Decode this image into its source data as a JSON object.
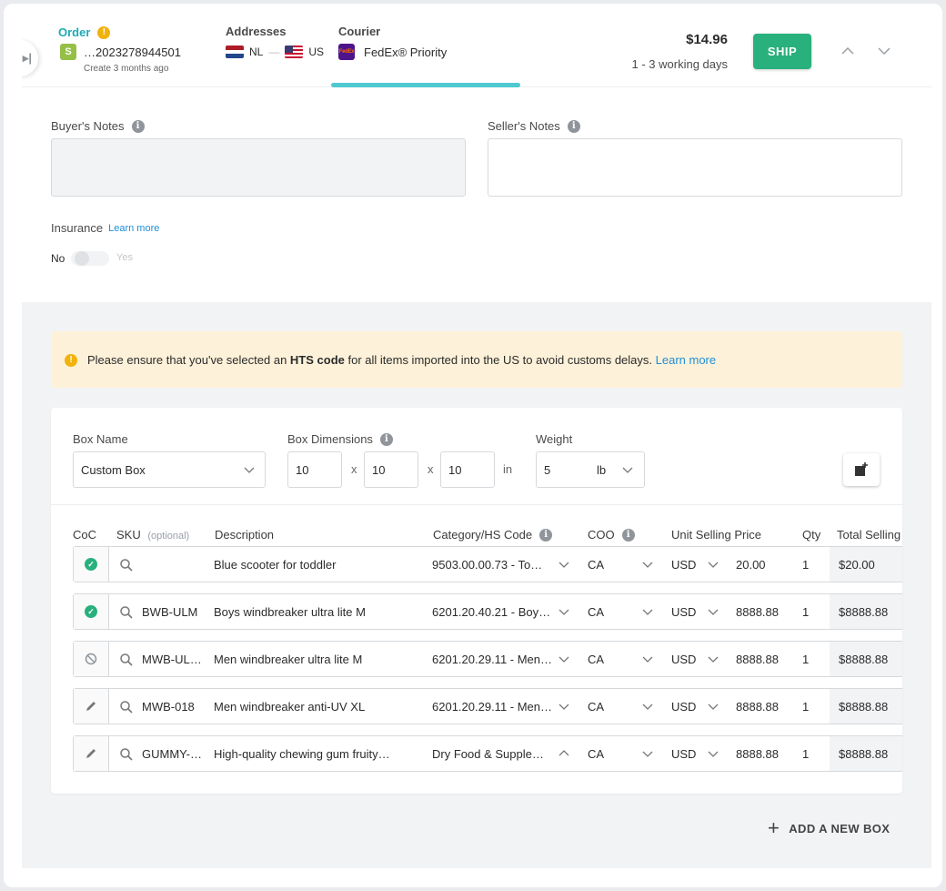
{
  "header": {
    "order_label": "Order",
    "order_warning": "!",
    "order_id": "…2023278944501",
    "order_created": "Create 3 months ago",
    "addresses_label": "Addresses",
    "from_country": "NL",
    "separator": "—",
    "to_country": "US",
    "courier_label": "Courier",
    "courier_name": "FedEx® Priority",
    "courier_icon_text": "FedEx",
    "price": "$14.96",
    "eta": "1 - 3 working days",
    "ship_label": "SHIP"
  },
  "notes": {
    "buyer_label": "Buyer's Notes",
    "seller_label": "Seller's Notes"
  },
  "insurance": {
    "label": "Insurance",
    "learn_more": "Learn more",
    "no": "No",
    "yes": "Yes"
  },
  "banner": {
    "text_before": "Please ensure that you've selected an ",
    "bold": "HTS code",
    "text_after": " for all items imported into the US to avoid customs delays. ",
    "link": "Learn more"
  },
  "box": {
    "name_label": "Box Name",
    "name_value": "Custom Box",
    "dims_label": "Box Dimensions",
    "dim_l": "10",
    "dim_w": "10",
    "dim_h": "10",
    "dim_x": "x",
    "dim_unit": "in",
    "weight_label": "Weight",
    "weight_value": "5",
    "weight_unit": "lb"
  },
  "table": {
    "headers": {
      "coc": "CoC",
      "sku": "SKU",
      "sku_optional": "(optional)",
      "description": "Description",
      "category": "Category/HS Code",
      "coo": "COO",
      "unit_price": "Unit Selling Price",
      "qty": "Qty",
      "total": "Total Selling"
    },
    "rows": [
      {
        "coc": "check-circle-icon",
        "sku": "",
        "description": "Blue scooter for toddler",
        "category": "9503.00.00.73 - To…",
        "coo": "CA",
        "currency": "USD",
        "price": "20.00",
        "qty": "1",
        "total": "$20.00"
      },
      {
        "coc": "check-circle-icon",
        "sku": "BWB-ULM",
        "description": "Boys windbreaker ultra lite M",
        "category": "6201.20.40.21 - Boy…",
        "coo": "CA",
        "currency": "USD",
        "price": "8888.88",
        "qty": "1",
        "total": "$8888.88"
      },
      {
        "coc": "block-icon",
        "sku": "MWB-UL…",
        "description": "Men windbreaker ultra lite M",
        "category": "6201.20.29.11 - Men…",
        "coo": "CA",
        "currency": "USD",
        "price": "8888.88",
        "qty": "1",
        "total": "$8888.88"
      },
      {
        "coc": "pencil-icon",
        "sku": "MWB-018",
        "description": "Men windbreaker anti-UV XL",
        "category": "6201.20.29.11 - Men…",
        "coo": "CA",
        "currency": "USD",
        "price": "8888.88",
        "qty": "1",
        "total": "$8888.88"
      },
      {
        "coc": "pencil-icon",
        "sku": "GUMMY-…",
        "description": "High-quality chewing gum fruity…",
        "category": "Dry Food & Supple…",
        "coo": "CA",
        "currency": "USD",
        "price": "8888.88",
        "qty": "1",
        "total": "$8888.88"
      }
    ]
  },
  "add_box_label": "ADD A NEW BOX"
}
